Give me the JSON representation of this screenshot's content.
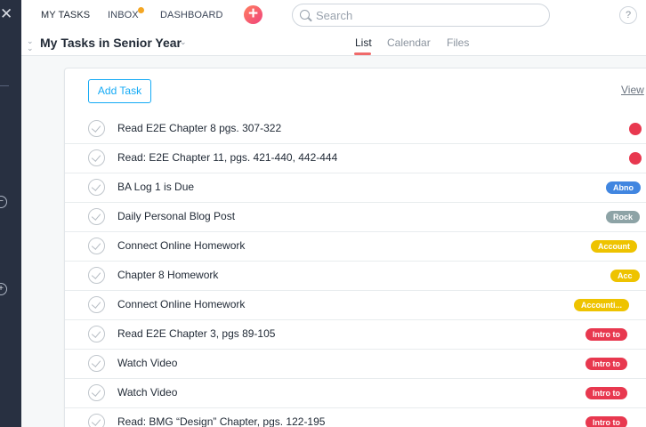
{
  "sidebar": {
    "close_glyph": "✕",
    "minus_glyph": "−",
    "plus_glyph": "+"
  },
  "topnav": {
    "my_tasks": "MY TASKS",
    "inbox": "INBOX",
    "dashboard": "DASHBOARD",
    "add_glyph": "+",
    "help_glyph": "?"
  },
  "search": {
    "placeholder": "Search"
  },
  "header": {
    "title": "My Tasks in Senior Year",
    "tabs": {
      "list": "List",
      "calendar": "Calendar",
      "files": "Files"
    }
  },
  "toolbar": {
    "add_task": "Add Task",
    "view": "View"
  },
  "colors": {
    "red": "#e8384f",
    "blue": "#4186e0",
    "gray": "#8da3a6",
    "yellow": "#eec300"
  },
  "tasks": [
    {
      "name": "Read E2E Chapter 8 pgs. 307-322",
      "tag": "",
      "tag_color": "#e8384f"
    },
    {
      "name": "Read: E2E Chapter 11, pgs. 421-440, 442-444",
      "tag": "",
      "tag_color": "#e8384f"
    },
    {
      "name": "BA Log 1 is Due",
      "tag": "Abno",
      "tag_color": "#4186e0"
    },
    {
      "name": "Daily Personal Blog Post",
      "tag": "Rock",
      "tag_color": "#8da3a6"
    },
    {
      "name": "Connect Online Homework",
      "tag": "Account",
      "tag_color": "#eec300"
    },
    {
      "name": "Chapter 8 Homework",
      "tag": "Acc",
      "tag_color": "#eec300"
    },
    {
      "name": "Connect Online Homework",
      "tag": "Accounti...",
      "tag_color": "#eec300"
    },
    {
      "name": "Read E2E Chapter 3, pgs 89-105",
      "tag": "Intro to",
      "tag_color": "#e8384f"
    },
    {
      "name": "Watch Video",
      "tag": "Intro to",
      "tag_color": "#e8384f"
    },
    {
      "name": "Watch Video",
      "tag": "Intro to",
      "tag_color": "#e8384f"
    },
    {
      "name": "Read: BMG “Design” Chapter, pgs. 122-195",
      "tag": "Intro to",
      "tag_color": "#e8384f"
    }
  ]
}
